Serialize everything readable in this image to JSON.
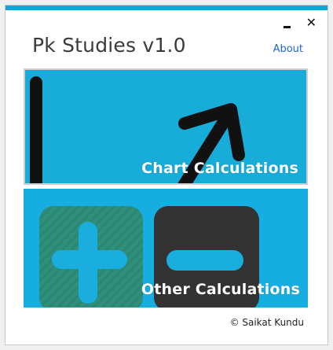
{
  "window": {
    "title": "Pk Studies v1.0",
    "minimize_symbol": "",
    "close_symbol": "✕",
    "accent_color": "#1aa3d9"
  },
  "header": {
    "about_label": "About"
  },
  "tiles": [
    {
      "label": "Chart Calculations",
      "color": "#18acd9",
      "icon": "trend-arrow-icon"
    },
    {
      "label": "Other Calculations",
      "color": "#16aee0",
      "icon": "plus-minus-icon"
    }
  ],
  "footer": {
    "copyright": "© Saikat Kundu"
  }
}
